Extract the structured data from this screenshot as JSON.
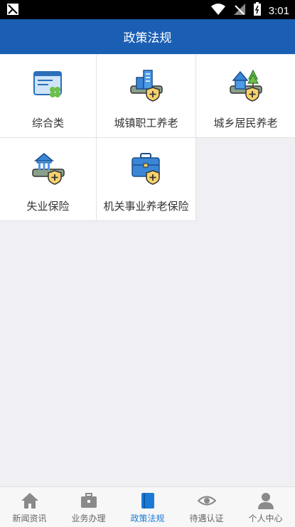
{
  "status_bar": {
    "time": "3:01",
    "icons": [
      "notification-icon",
      "wifi-icon",
      "signal-icon",
      "battery-icon"
    ]
  },
  "header": {
    "title": "政策法规"
  },
  "categories": [
    {
      "label": "综合类",
      "icon": "document-icon"
    },
    {
      "label": "城镇职工养老",
      "icon": "city-building-shield-icon"
    },
    {
      "label": "城乡居民养老",
      "icon": "house-tree-shield-icon"
    },
    {
      "label": "失业保险",
      "icon": "bank-shield-icon"
    },
    {
      "label": "机关事业养老保险",
      "icon": "briefcase-shield-icon"
    }
  ],
  "bottom_nav": {
    "items": [
      {
        "label": "新闻资讯",
        "icon": "home-icon"
      },
      {
        "label": "业务办理",
        "icon": "briefcase-icon"
      },
      {
        "label": "政策法规",
        "icon": "book-icon",
        "active": true
      },
      {
        "label": "待遇认证",
        "icon": "eye-icon"
      },
      {
        "label": "个人中心",
        "icon": "person-icon"
      }
    ]
  },
  "colors": {
    "primary": "#1a5fb4",
    "active_tab": "#1a7bd6",
    "background": "#efeff4"
  }
}
